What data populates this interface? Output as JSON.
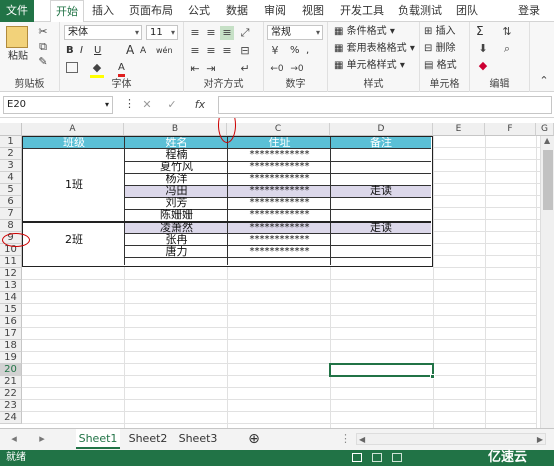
{
  "ribbon_tabs": [
    "文件",
    "开始",
    "插入",
    "页面布局",
    "公式",
    "数据",
    "审阅",
    "视图",
    "开发工具",
    "负载测试",
    "团队"
  ],
  "login_label": "登录",
  "clipboard": {
    "paste_label": "粘贴",
    "group_label": "剪贴板"
  },
  "font": {
    "name": "宋体",
    "size": "11",
    "group_label": "字体",
    "bold": "B",
    "italic": "I",
    "underline": "U",
    "grow": "A",
    "shrink": "A",
    "color_a": "A",
    "wen": "wén"
  },
  "alignment": {
    "group_label": "对齐方式"
  },
  "number": {
    "format": "常规",
    "percent": "%",
    "comma": ",",
    "group_label": "数字"
  },
  "styles": {
    "conditional": "条件格式",
    "table": "套用表格格式",
    "cell": "单元格样式",
    "group_label": "样式"
  },
  "cells": {
    "insert": "插入",
    "delete": "删除",
    "format": "格式",
    "group_label": "单元格"
  },
  "editing": {
    "sigma": "Σ",
    "group_label": "编辑"
  },
  "formula_bar": {
    "name_box": "E20",
    "fx": "fx",
    "cancel": "✕",
    "enter": "✓"
  },
  "column_headers": [
    "A",
    "B",
    "C",
    "D",
    "E",
    "F",
    "G"
  ],
  "row_numbers": [
    "1",
    "2",
    "3",
    "4",
    "5",
    "6",
    "7",
    "8",
    "9",
    "10",
    "11",
    "12",
    "13",
    "14",
    "15",
    "16",
    "17",
    "18",
    "19",
    "20",
    "21",
    "22",
    "23",
    "24"
  ],
  "table": {
    "headers": [
      "班级",
      "姓名",
      "住址",
      "备注"
    ],
    "groups": [
      {
        "label": "1班"
      },
      {
        "label": "2班"
      }
    ],
    "rows": [
      {
        "name": "程楠",
        "address": "************",
        "note": ""
      },
      {
        "name": "夏竹风",
        "address": "************",
        "note": ""
      },
      {
        "name": "杨洋",
        "address": "************",
        "note": ""
      },
      {
        "name": "冯田",
        "address": "************",
        "note": "走读"
      },
      {
        "name": "刘芳",
        "address": "************",
        "note": ""
      },
      {
        "name": "陈姗姗",
        "address": "************",
        "note": ""
      },
      {
        "name": "凌萧然",
        "address": "************",
        "note": "走读"
      },
      {
        "name": "张冉",
        "address": "************",
        "note": ""
      },
      {
        "name": "唐力",
        "address": "************",
        "note": ""
      }
    ]
  },
  "sheets": [
    "Sheet1",
    "Sheet2",
    "Sheet3"
  ],
  "add_sheet": "⊕",
  "status": "就绪",
  "watermark": "亿速云",
  "colors": {
    "accent": "#217346",
    "header_fill": "#5bc0d6",
    "highlight_row": "#dcd8ea",
    "annotation": "#cc0000"
  }
}
